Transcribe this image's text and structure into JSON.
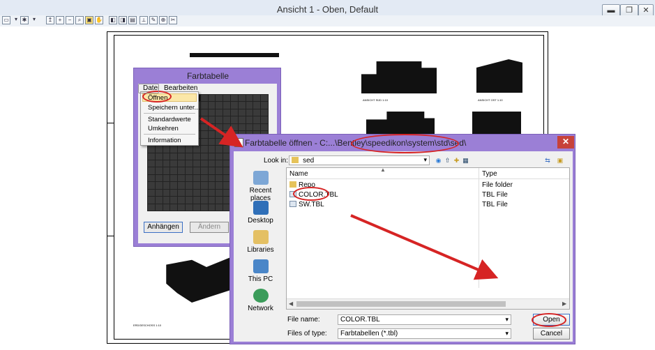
{
  "window": {
    "title": "Ansicht 1 - Oben, Default",
    "controls": {
      "minimize": "▬",
      "restore": "❐",
      "close": "✕"
    }
  },
  "toolbar": {
    "icons": [
      "page-icon",
      "dropdown-icon",
      "settings-icon",
      "dropdown-icon",
      "pan-icon",
      "zoom-in-icon",
      "zoom-out-icon",
      "zoom-window-icon",
      "zoom-fit-icon",
      "hand-icon",
      "view-prev-icon",
      "view-next-icon",
      "view-icon",
      "measure-icon",
      "tool-icon",
      "zoom-icon",
      "tool-icon"
    ]
  },
  "drawing": {
    "label_view_1": "ANSICHT SÜD 1:10",
    "label_view_2": "ANSICHT OST 1:10",
    "label_plan": "ERDGESCHOSS 1:10"
  },
  "farbtabelle": {
    "title": "Farbtabelle",
    "menu": {
      "file": "Datei",
      "edit": "Bearbeiten"
    },
    "file_menu_items": [
      "Öffnen",
      "Speichern unter...",
      "Standardwerte",
      "Umkehren",
      "Information"
    ],
    "buttons": {
      "apply": "Anhängen",
      "change": "Ändern"
    }
  },
  "open_dialog": {
    "title": "Farbtabelle öffnen - C:...\\Bentley\\speedikon\\system\\std\\sed\\",
    "look_in_label": "Look in:",
    "look_in_value": "sed",
    "places": [
      "Recent places",
      "Desktop",
      "Libraries",
      "This PC",
      "Network"
    ],
    "columns": {
      "name": "Name",
      "type": "Type"
    },
    "files": [
      {
        "name": "Repo",
        "type": "File folder",
        "icon": "folder-icon"
      },
      {
        "name": "COLOR.TBL",
        "type": "TBL File",
        "icon": "file-icon"
      },
      {
        "name": "SW.TBL",
        "type": "TBL File",
        "icon": "file-icon"
      }
    ],
    "file_name_label": "File name:",
    "file_name_value": "COLOR.TBL",
    "file_type_label": "Files of type:",
    "file_type_value": "Farbtabellen (*.tbl)",
    "buttons": {
      "open": "Open",
      "cancel": "Cancel"
    }
  },
  "colors": {
    "dialog_frame": "#9b7fd6",
    "highlight": "#d62424",
    "menu_highlight": "#fbe7a8",
    "close_button": "#c7423a"
  }
}
